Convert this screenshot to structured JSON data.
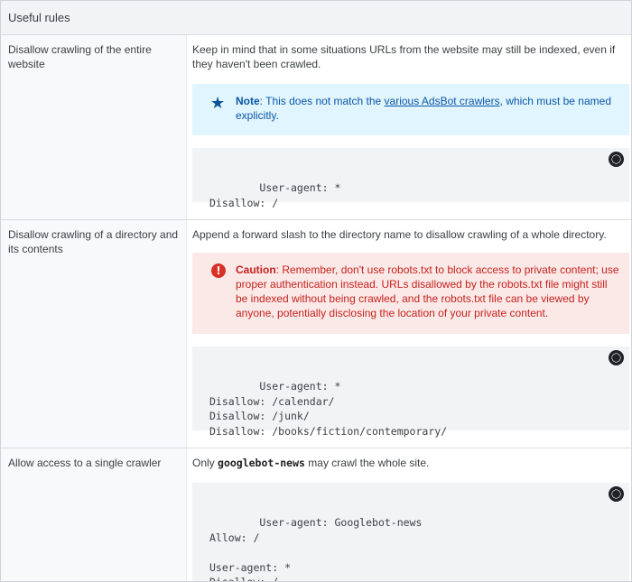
{
  "header": {
    "title": "Useful rules"
  },
  "rows": [
    {
      "left": "Disallow crawling of the entire website",
      "desc": "Keep in mind that in some situations URLs from the website may still be indexed, even if they haven't been crawled.",
      "note": {
        "label": "Note",
        "text_before": ": This does not match the ",
        "link": "various AdsBot crawlers",
        "text_after": ", which must be named explicitly."
      },
      "code": "User-agent: *\nDisallow: /"
    },
    {
      "left": "Disallow crawling of a directory and its contents",
      "desc": "Append a forward slash to the directory name to disallow crawling of a whole directory.",
      "caution": {
        "label": "Caution",
        "text": ": Remember, don't use robots.txt to block access to private content; use proper authentication instead. URLs disallowed by the robots.txt file might still be indexed without being crawled, and the robots.txt file can be viewed by anyone, potentially disclosing the location of your private content."
      },
      "code": "User-agent: *\nDisallow: /calendar/\nDisallow: /junk/\nDisallow: /books/fiction/contemporary/"
    },
    {
      "left": "Allow access to a single crawler",
      "desc_before": "Only ",
      "desc_code": "googlebot-news",
      "desc_after": " may crawl the whole site.",
      "code": "User-agent: Googlebot-news\nAllow: /\n\nUser-agent: *\nDisallow: /"
    }
  ],
  "icons": {
    "note": "star-icon",
    "caution": "error-icon",
    "theme": "dark-theme-toggle-icon"
  }
}
